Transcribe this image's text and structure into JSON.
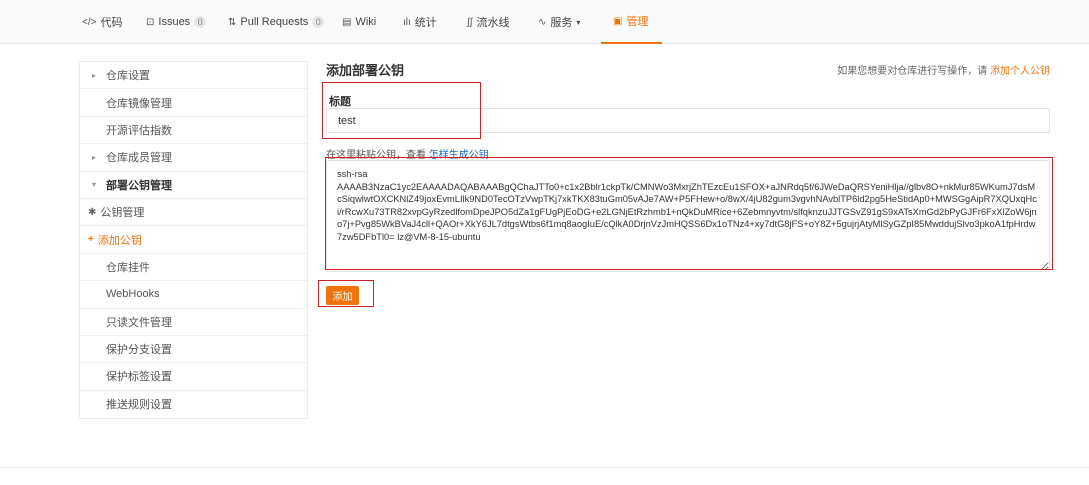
{
  "nav": {
    "tabs": [
      {
        "icon": "</>",
        "label": "代码",
        "badge": ""
      },
      {
        "icon": "⊡",
        "label": "Issues",
        "badge": "0"
      },
      {
        "icon": "⇅",
        "label": "Pull Requests",
        "badge": "0"
      },
      {
        "icon": "▤",
        "label": "Wiki",
        "badge": ""
      },
      {
        "icon": "ılı",
        "label": "统计",
        "badge": ""
      },
      {
        "icon": "∫∫",
        "label": "流水线",
        "badge": ""
      },
      {
        "icon": "∿",
        "label": "服务",
        "badge": ""
      },
      {
        "icon": "▣",
        "label": "管理",
        "badge": ""
      }
    ],
    "service_caret": "▾",
    "active_color": "#f0730b"
  },
  "sidebar": {
    "items": [
      {
        "label": "仓库设置"
      },
      {
        "label": "仓库镜像管理"
      },
      {
        "label": "开源评估指数"
      },
      {
        "label": "仓库成员管理"
      },
      {
        "label": "部署公钥管理"
      },
      {
        "label": "公钥管理",
        "icon": "✱"
      },
      {
        "label": "添加公钥",
        "icon": "+"
      },
      {
        "label": "仓库挂件"
      },
      {
        "label": "WebHooks"
      },
      {
        "label": "只读文件管理"
      },
      {
        "label": "保护分支设置"
      },
      {
        "label": "保护标签设置"
      },
      {
        "label": "推送规则设置"
      }
    ]
  },
  "main": {
    "title": "添加部署公钥",
    "hint_prefix": "如果您想要对仓库进行写操作，请",
    "hint_link": "添加个人公钥",
    "field_label": "标题",
    "title_value": "test",
    "paste_prefix": "在这里粘贴公钥，查看",
    "paste_link": "怎样生成公钥",
    "key_value": "ssh-rsa\nAAAAB3NzaC1yc2EAAAADAQABAAABgQChaJTTo0+c1x2Bblr1ckpTk/CMNWo3MxrjZhTEzcEu1SFOX+aJNRdq5f/6JWeDaQRSYeniHlja//glbv8O+nkMur85WKumJ7dsMcSiqwlwtOXCKNlZ49joxEvmLIlk9ND0TecOTzVwpTKj7xkTKX83tuGm05vAJe7AW+P5FHew+o/8wX/4jU82gum3vgvhNAvblTP6ld2pg5HeStidAp0+MWSGgAipR7XQUxqHci/rRcwXu73TR82xvpGyRzedlfomDpeJPO5dZa1gFUgPjEoDG+e2LGNjEtRzhmb1+nQkDuMRice+6Zebmnyvtm/slfqknzuJJTGSvZ91gS9xATsXmGd2bPyGJFr6FxXlZoW6jno7j+Pvg85WkBVaJ4cll+QAOr+XkY6JL7dtgsWtbs6f1mq8aogIuE/cQlkA0DrjnVzJmHQSS6Dx1oTNz4+xy7dtG8jFS+oY8Z+5gujrjAtyMlSyGZpI85MwddujSlvo3pkoA1fpHrdw7zw5DFbTl0= lz@VM-8-15-ubuntu",
    "add_button": "添加"
  }
}
